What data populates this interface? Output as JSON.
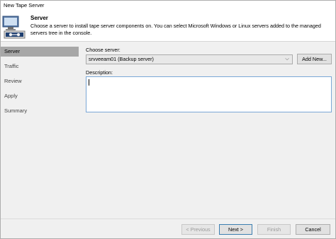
{
  "window": {
    "title": "New Tape Server"
  },
  "header": {
    "title": "Server",
    "description": "Choose a server to install tape server components on. You can select Microsoft Windows or Linux servers added to the managed servers tree in the console."
  },
  "sidebar": {
    "items": [
      {
        "label": "Server",
        "active": true
      },
      {
        "label": "Traffic",
        "active": false
      },
      {
        "label": "Review",
        "active": false
      },
      {
        "label": "Apply",
        "active": false
      },
      {
        "label": "Summary",
        "active": false
      }
    ]
  },
  "form": {
    "choose_server_label": "Choose server:",
    "server_value": "srvveeam01 (Backup server)",
    "add_new_label": "Add New...",
    "description_label": "Description:",
    "description_value": ""
  },
  "footer": {
    "previous_label": "< Previous",
    "next_label": "Next >",
    "finish_label": "Finish",
    "cancel_label": "Cancel"
  },
  "colors": {
    "active_sidebar": "#a7a7a7",
    "window_bg": "#f0f0f0",
    "focus_border": "#7aa7d6"
  }
}
